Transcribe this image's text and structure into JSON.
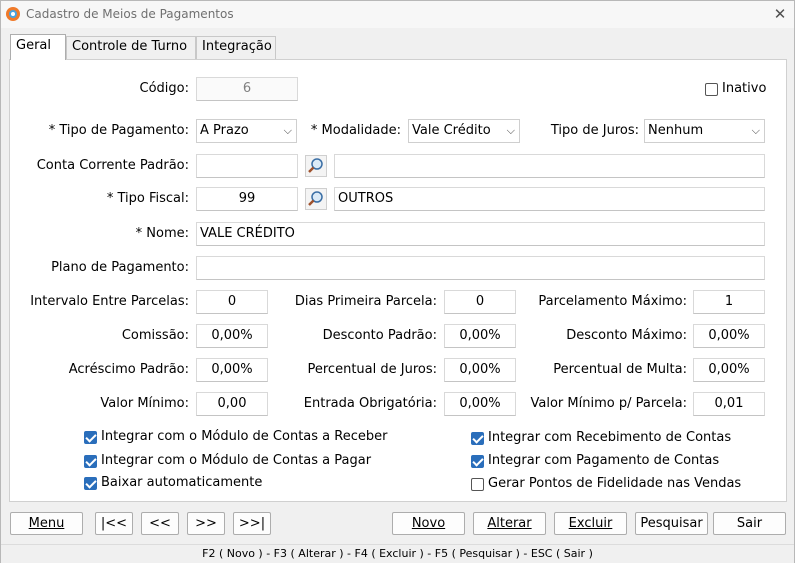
{
  "window": {
    "title": "Cadastro de Meios de Pagamentos"
  },
  "tabs": [
    "Geral",
    "Controle de Turno",
    "Integração"
  ],
  "fields": {
    "codigo": {
      "label": "Código:",
      "value": "6"
    },
    "inativo": {
      "label": "Inativo",
      "checked": false
    },
    "tipo_pagamento": {
      "label": "* Tipo de Pagamento:",
      "value": "A Prazo"
    },
    "modalidade": {
      "label": "* Modalidade:",
      "value": "Vale Crédito"
    },
    "tipo_juros": {
      "label": "Tipo de Juros:",
      "value": "Nenhum"
    },
    "conta_corrente": {
      "label": "Conta Corrente Padrão:",
      "code": "",
      "desc": ""
    },
    "tipo_fiscal": {
      "label": "* Tipo Fiscal:",
      "code": "99",
      "desc": "OUTROS"
    },
    "nome": {
      "label": "* Nome:",
      "value": "VALE CRÉDITO"
    },
    "plano_pagamento": {
      "label": "Plano de Pagamento:",
      "value": ""
    },
    "intervalo_parcelas": {
      "label": "Intervalo Entre Parcelas:",
      "value": "0"
    },
    "dias_primeira_parcela": {
      "label": "Dias Primeira Parcela:",
      "value": "0"
    },
    "parcelamento_maximo": {
      "label": "Parcelamento Máximo:",
      "value": "1"
    },
    "comissao": {
      "label": "Comissão:",
      "value": "0,00%"
    },
    "desconto_padrao": {
      "label": "Desconto Padrão:",
      "value": "0,00%"
    },
    "desconto_maximo": {
      "label": "Desconto Máximo:",
      "value": "0,00%"
    },
    "acrescimo_padrao": {
      "label": "Acréscimo Padrão:",
      "value": "0,00%"
    },
    "percentual_juros": {
      "label": "Percentual de Juros:",
      "value": "0,00%"
    },
    "percentual_multa": {
      "label": "Percentual de Multa:",
      "value": "0,00%"
    },
    "valor_minimo": {
      "label": "Valor Mínimo:",
      "value": "0,00"
    },
    "entrada_obrigatoria": {
      "label": "Entrada Obrigatória:",
      "value": "0,00%"
    },
    "valor_minimo_parcela": {
      "label": "Valor Mínimo p/ Parcela:",
      "value": "0,01"
    }
  },
  "checkboxes": [
    {
      "label": "Integrar com o Módulo de Contas a Receber",
      "checked": true
    },
    {
      "label": "Integrar com o Módulo de Contas a Pagar",
      "checked": true
    },
    {
      "label": "Baixar automaticamente",
      "checked": true
    },
    {
      "label": "Integrar com Recebimento de Contas",
      "checked": true
    },
    {
      "label": "Integrar com Pagamento de Contas",
      "checked": true
    },
    {
      "label": "Gerar Pontos de Fidelidade nas Vendas",
      "checked": false
    }
  ],
  "buttons": {
    "menu": "Menu",
    "first": "|<<",
    "prev": "<<",
    "next": ">>",
    "last": ">>|",
    "novo": "Novo",
    "alterar": "Alterar",
    "excluir": "Excluir",
    "pesquisar": "Pesquisar",
    "sair": "Sair"
  },
  "status_bar": "F2 ( Novo ) - F3 ( Alterar ) - F4 ( Excluir ) - F5 ( Pesquisar ) - ESC ( Sair )",
  "icons": {
    "app": "app-logo-icon",
    "close": "close-icon",
    "search": "magnifier-icon",
    "dropdown": "chevron-down-icon"
  },
  "colors": {
    "checkbox_on": "#2a6ebb",
    "panel_bg": "#ffffff",
    "window_bg": "#f0f0f0"
  }
}
